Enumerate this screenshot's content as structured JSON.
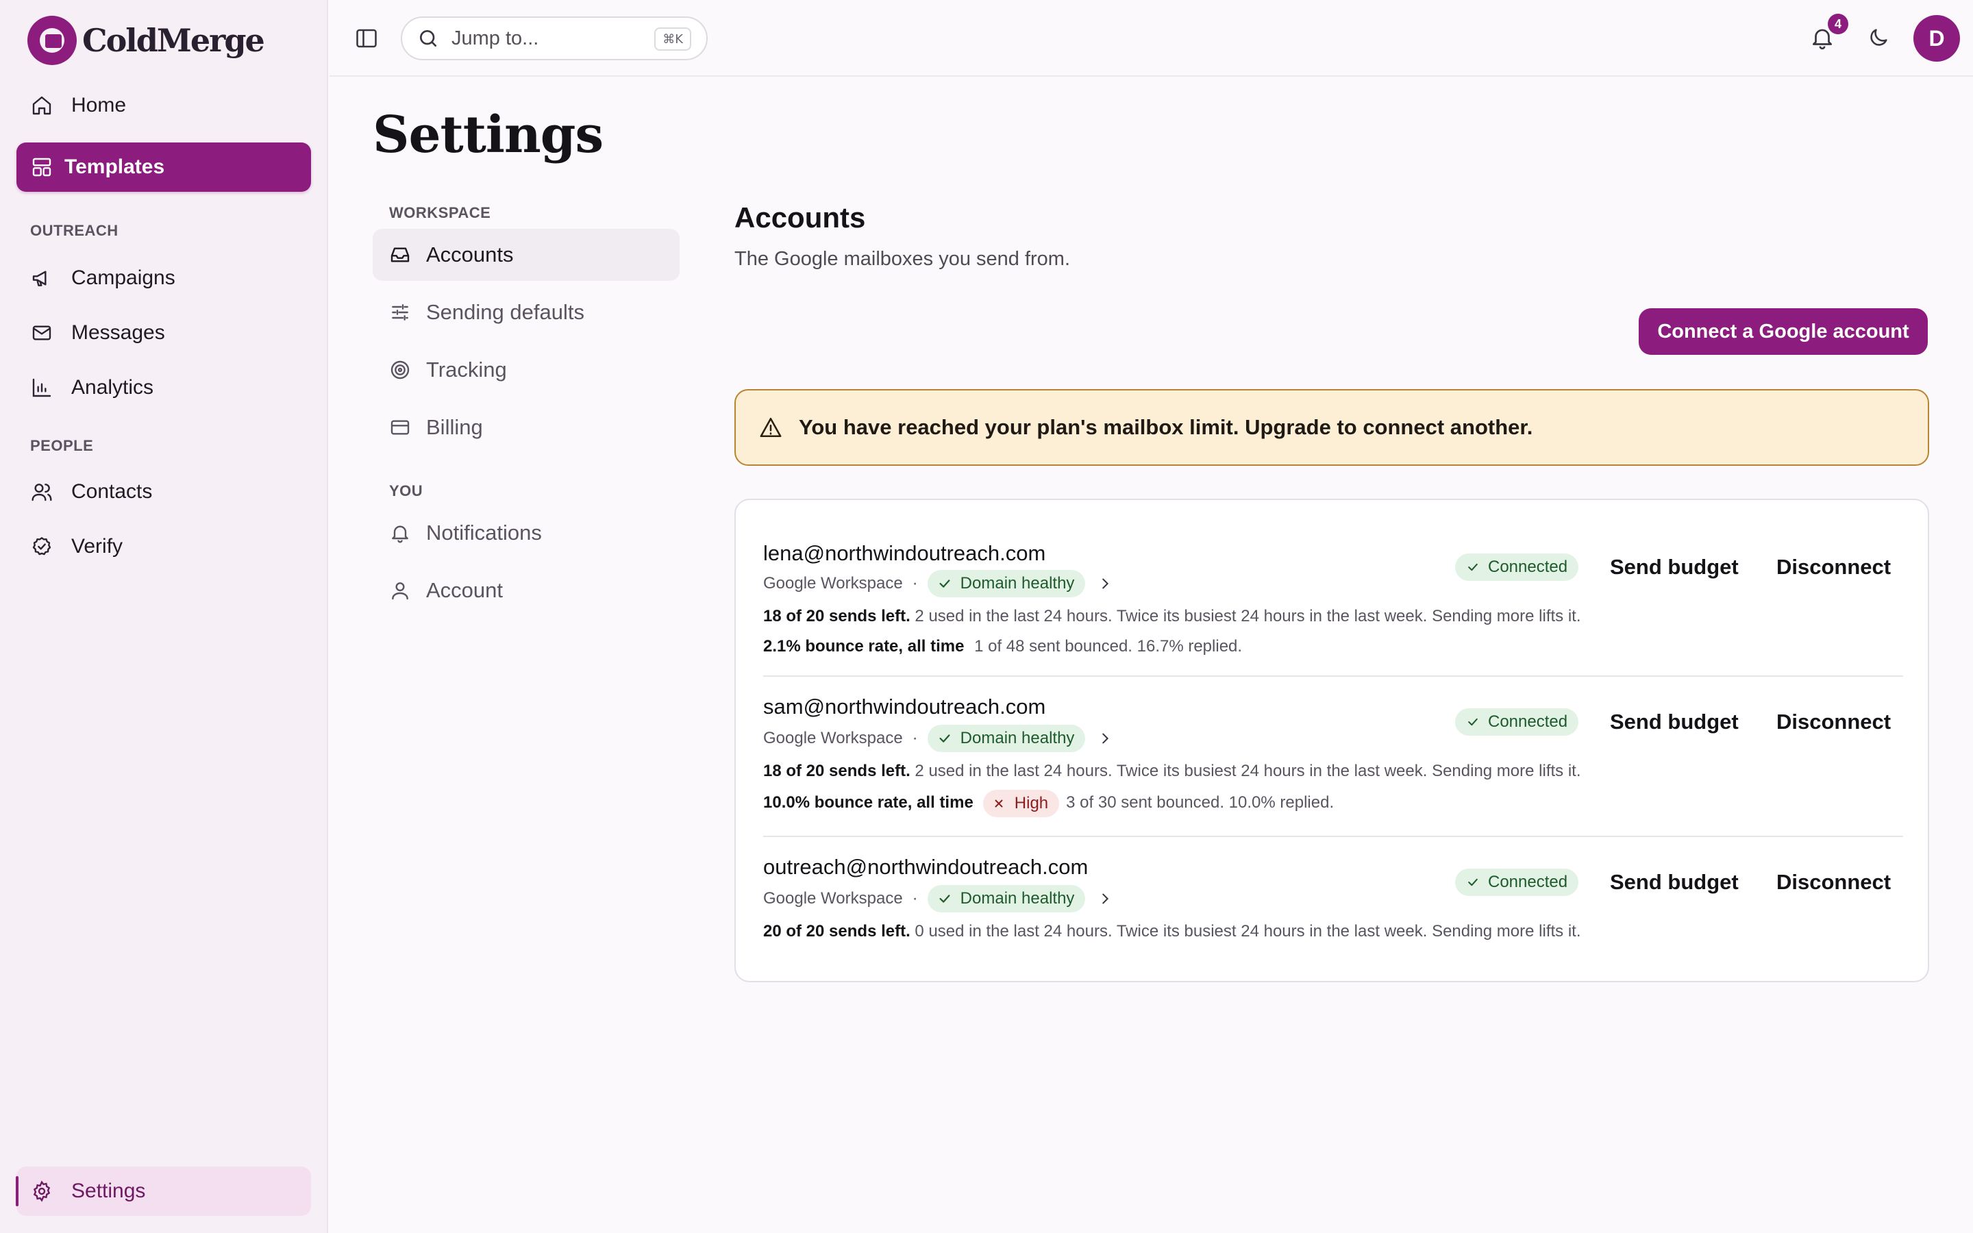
{
  "app": {
    "name": "ColdMerge"
  },
  "sidebar": {
    "items": [
      {
        "label": "Home"
      },
      {
        "label": "Templates"
      },
      {
        "label": "Campaigns"
      },
      {
        "label": "Messages"
      },
      {
        "label": "Analytics"
      },
      {
        "label": "Contacts"
      },
      {
        "label": "Verify"
      },
      {
        "label": "Settings"
      }
    ],
    "sections": {
      "outreach": "OUTREACH",
      "people": "PEOPLE"
    }
  },
  "topbar": {
    "search_placeholder": "Jump to...",
    "search_shortcut": "⌘K",
    "notification_count": "4",
    "avatar_initial": "D"
  },
  "page": {
    "title": "Settings"
  },
  "settings_nav": {
    "workspace_label": "WORKSPACE",
    "you_label": "YOU",
    "items": [
      {
        "label": "Accounts"
      },
      {
        "label": "Sending defaults"
      },
      {
        "label": "Tracking"
      },
      {
        "label": "Billing"
      },
      {
        "label": "Notifications"
      },
      {
        "label": "Account"
      }
    ]
  },
  "accounts": {
    "title": "Accounts",
    "description": "The Google mailboxes you send from.",
    "connect_button": "Connect a Google account",
    "alert": "You have reached your plan's mailbox limit. Upgrade to connect another.",
    "list": [
      {
        "email": "lena@northwindoutreach.com",
        "provider": "Google Workspace",
        "domain_status": "Domain healthy",
        "status": "Connected",
        "sends_strong": "18 of 20 sends left.",
        "sends_detail": "2 used in the last 24 hours. Twice its busiest 24 hours in the last week. Sending more lifts it.",
        "bounce_strong": "2.1% bounce rate, all time",
        "bounce_detail": "1 of 48 sent bounced. 16.7% replied."
      },
      {
        "email": "sam@northwindoutreach.com",
        "provider": "Google Workspace",
        "domain_status": "Domain healthy",
        "status": "Connected",
        "sends_strong": "18 of 20 sends left.",
        "sends_detail": "2 used in the last 24 hours. Twice its busiest 24 hours in the last week. Sending more lifts it.",
        "bounce_strong": "10.0% bounce rate, all time",
        "bounce_flag": "High",
        "bounce_detail": "3 of 30 sent bounced. 10.0% replied."
      },
      {
        "email": "outreach@northwindoutreach.com",
        "provider": "Google Workspace",
        "domain_status": "Domain healthy",
        "status": "Connected",
        "sends_strong": "20 of 20 sends left.",
        "sends_detail": "0 used in the last 24 hours. Twice its busiest 24 hours in the last week. Sending more lifts it."
      }
    ],
    "actions": {
      "send_budget": "Send budget",
      "disconnect": "Disconnect"
    }
  },
  "colors": {
    "accent": "#8c1c7d",
    "success_bg": "#e2f3e5",
    "danger_bg": "#fbe6e6",
    "warning_bg": "#fcefd6"
  },
  "icons": {
    "home": "home-icon",
    "templates": "layout-icon",
    "campaigns": "megaphone-icon",
    "messages": "mail-icon",
    "analytics": "bar-chart-icon",
    "contacts": "users-icon",
    "verify": "check-circle-icon",
    "settings": "gear-icon"
  }
}
